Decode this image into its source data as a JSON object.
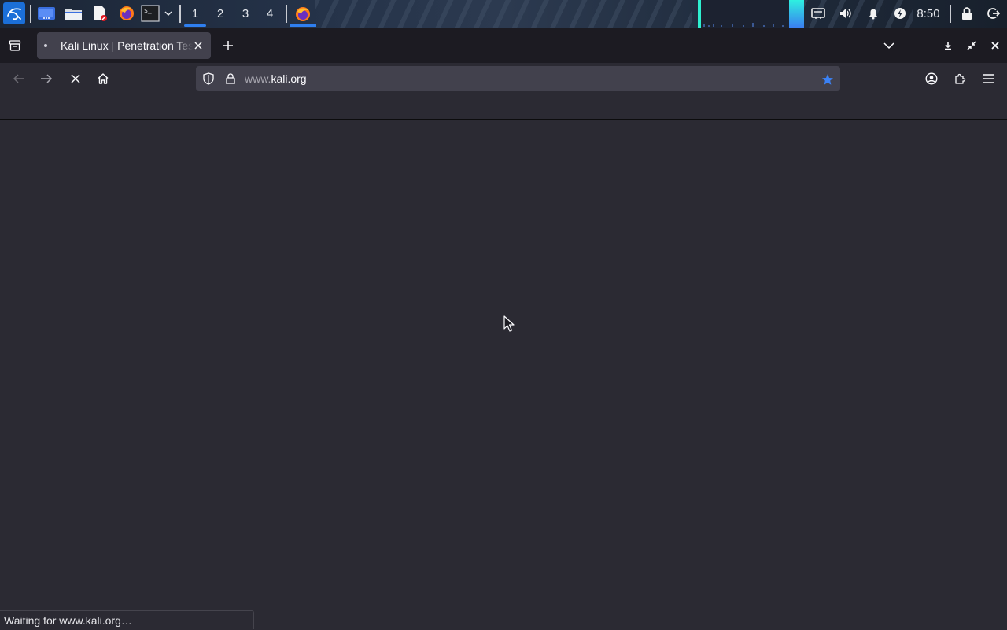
{
  "panel": {
    "workspaces": [
      "1",
      "2",
      "3",
      "4"
    ],
    "active_workspace": "1",
    "clock": "8:50",
    "launchers": [
      "kali-menu-icon",
      "show-desktop-icon",
      "file-manager-icon",
      "text-editor-icon",
      "firefox-icon",
      "terminal-icon"
    ],
    "tray": [
      "network-icon",
      "volume-icon",
      "bell-icon",
      "power-icon",
      "lock-icon",
      "logout-icon"
    ]
  },
  "browser": {
    "tab": {
      "title": "Kali Linux | Penetration Testing and Ethical Hacking Linux Distribution"
    },
    "url": {
      "prefix": "www.",
      "domain": "kali.org"
    },
    "status": "Waiting for www.kali.org…"
  },
  "colors": {
    "accent": "#2f7ff0",
    "content_bg": "#2b2a33",
    "tabbar_bg": "#1c1b22",
    "urlbar_bg": "#42414d",
    "bookmark_star": "#3b82f6"
  }
}
